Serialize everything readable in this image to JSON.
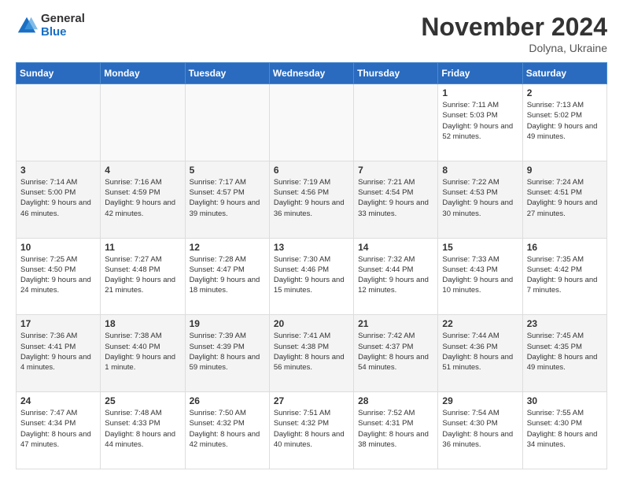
{
  "header": {
    "logo": {
      "general": "General",
      "blue": "Blue"
    },
    "title": "November 2024",
    "subtitle": "Dolyna, Ukraine"
  },
  "weekdays": [
    "Sunday",
    "Monday",
    "Tuesday",
    "Wednesday",
    "Thursday",
    "Friday",
    "Saturday"
  ],
  "weeks": [
    [
      null,
      null,
      null,
      null,
      null,
      {
        "day": 1,
        "sunrise": "7:11 AM",
        "sunset": "5:03 PM",
        "daylight": "9 hours and 52 minutes."
      },
      {
        "day": 2,
        "sunrise": "7:13 AM",
        "sunset": "5:02 PM",
        "daylight": "9 hours and 49 minutes."
      }
    ],
    [
      {
        "day": 3,
        "sunrise": "7:14 AM",
        "sunset": "5:00 PM",
        "daylight": "9 hours and 46 minutes."
      },
      {
        "day": 4,
        "sunrise": "7:16 AM",
        "sunset": "4:59 PM",
        "daylight": "9 hours and 42 minutes."
      },
      {
        "day": 5,
        "sunrise": "7:17 AM",
        "sunset": "4:57 PM",
        "daylight": "9 hours and 39 minutes."
      },
      {
        "day": 6,
        "sunrise": "7:19 AM",
        "sunset": "4:56 PM",
        "daylight": "9 hours and 36 minutes."
      },
      {
        "day": 7,
        "sunrise": "7:21 AM",
        "sunset": "4:54 PM",
        "daylight": "9 hours and 33 minutes."
      },
      {
        "day": 8,
        "sunrise": "7:22 AM",
        "sunset": "4:53 PM",
        "daylight": "9 hours and 30 minutes."
      },
      {
        "day": 9,
        "sunrise": "7:24 AM",
        "sunset": "4:51 PM",
        "daylight": "9 hours and 27 minutes."
      }
    ],
    [
      {
        "day": 10,
        "sunrise": "7:25 AM",
        "sunset": "4:50 PM",
        "daylight": "9 hours and 24 minutes."
      },
      {
        "day": 11,
        "sunrise": "7:27 AM",
        "sunset": "4:48 PM",
        "daylight": "9 hours and 21 minutes."
      },
      {
        "day": 12,
        "sunrise": "7:28 AM",
        "sunset": "4:47 PM",
        "daylight": "9 hours and 18 minutes."
      },
      {
        "day": 13,
        "sunrise": "7:30 AM",
        "sunset": "4:46 PM",
        "daylight": "9 hours and 15 minutes."
      },
      {
        "day": 14,
        "sunrise": "7:32 AM",
        "sunset": "4:44 PM",
        "daylight": "9 hours and 12 minutes."
      },
      {
        "day": 15,
        "sunrise": "7:33 AM",
        "sunset": "4:43 PM",
        "daylight": "9 hours and 10 minutes."
      },
      {
        "day": 16,
        "sunrise": "7:35 AM",
        "sunset": "4:42 PM",
        "daylight": "9 hours and 7 minutes."
      }
    ],
    [
      {
        "day": 17,
        "sunrise": "7:36 AM",
        "sunset": "4:41 PM",
        "daylight": "9 hours and 4 minutes."
      },
      {
        "day": 18,
        "sunrise": "7:38 AM",
        "sunset": "4:40 PM",
        "daylight": "9 hours and 1 minute."
      },
      {
        "day": 19,
        "sunrise": "7:39 AM",
        "sunset": "4:39 PM",
        "daylight": "8 hours and 59 minutes."
      },
      {
        "day": 20,
        "sunrise": "7:41 AM",
        "sunset": "4:38 PM",
        "daylight": "8 hours and 56 minutes."
      },
      {
        "day": 21,
        "sunrise": "7:42 AM",
        "sunset": "4:37 PM",
        "daylight": "8 hours and 54 minutes."
      },
      {
        "day": 22,
        "sunrise": "7:44 AM",
        "sunset": "4:36 PM",
        "daylight": "8 hours and 51 minutes."
      },
      {
        "day": 23,
        "sunrise": "7:45 AM",
        "sunset": "4:35 PM",
        "daylight": "8 hours and 49 minutes."
      }
    ],
    [
      {
        "day": 24,
        "sunrise": "7:47 AM",
        "sunset": "4:34 PM",
        "daylight": "8 hours and 47 minutes."
      },
      {
        "day": 25,
        "sunrise": "7:48 AM",
        "sunset": "4:33 PM",
        "daylight": "8 hours and 44 minutes."
      },
      {
        "day": 26,
        "sunrise": "7:50 AM",
        "sunset": "4:32 PM",
        "daylight": "8 hours and 42 minutes."
      },
      {
        "day": 27,
        "sunrise": "7:51 AM",
        "sunset": "4:32 PM",
        "daylight": "8 hours and 40 minutes."
      },
      {
        "day": 28,
        "sunrise": "7:52 AM",
        "sunset": "4:31 PM",
        "daylight": "8 hours and 38 minutes."
      },
      {
        "day": 29,
        "sunrise": "7:54 AM",
        "sunset": "4:30 PM",
        "daylight": "8 hours and 36 minutes."
      },
      {
        "day": 30,
        "sunrise": "7:55 AM",
        "sunset": "4:30 PM",
        "daylight": "8 hours and 34 minutes."
      }
    ]
  ]
}
